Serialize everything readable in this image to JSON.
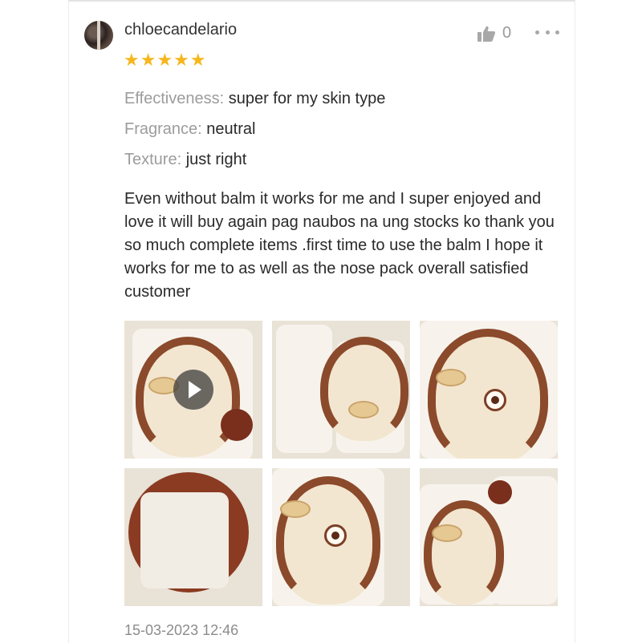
{
  "review": {
    "username": "chloecandelario",
    "rating_stars": 5,
    "stars_text": "★★★★★",
    "like_count": "0",
    "attributes": [
      {
        "key": "Effectiveness:",
        "value": "super for my skin type"
      },
      {
        "key": "Fragrance:",
        "value": "neutral"
      },
      {
        "key": "Texture:",
        "value": "just right"
      }
    ],
    "text": "Even without balm it works for me and I super enjoyed and love it will buy again pag naubos na ung stocks ko thank you so much complete items .first time to use the balm I hope it works for me to as well as the nose pack overall satisfied customer",
    "timestamp": "15-03-2023 12:46"
  },
  "icons": {
    "like": "thumbs-up-icon",
    "more": "more-options-icon",
    "play": "play-icon",
    "star": "star-icon"
  },
  "colors": {
    "star": "#f6b71d",
    "muted_label": "#9c9c9c",
    "text": "#2a2a2a",
    "timestamp": "#8c8c8c"
  }
}
